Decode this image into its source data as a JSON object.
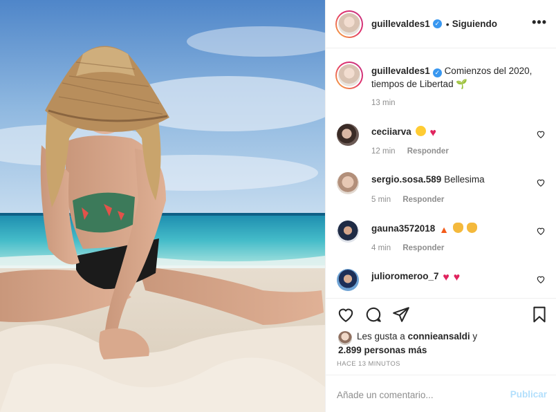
{
  "post": {
    "username": "guillevaldes1",
    "follow_state": "Siguiendo",
    "more_label": "•••",
    "verified_mark": "✓",
    "separator": "•"
  },
  "caption": {
    "username": "guillevaldes1",
    "text": "Comienzos del 2020, tiempos de Libertad",
    "emoji": "🌱",
    "time": "13 min"
  },
  "comments": [
    {
      "username": "ceciiarva",
      "text": "",
      "time": "12 min",
      "reply": "Responder"
    },
    {
      "username": "sergio.sosa.589",
      "text": "Bellesima",
      "time": "5 min",
      "reply": "Responder"
    },
    {
      "username": "gauna3572018",
      "text": "",
      "time": "4 min",
      "reply": "Responder"
    },
    {
      "username": "julioromeroo_7",
      "text": "",
      "time": "",
      "reply": ""
    }
  ],
  "likes": {
    "prefix": "Les gusta a",
    "user": "connieansaldi",
    "joiner": "y",
    "others": "2.899 personas más"
  },
  "posted_ago": "HACE 13 MINUTOS",
  "comment_box": {
    "placeholder": "Añade un comentario...",
    "publish_label": "Publicar"
  },
  "colors": {
    "accent": "#3897f0",
    "publish_disabled": "#b2dffc",
    "muted": "#8e8e8e",
    "heart": "#e0245e"
  },
  "icons": [
    "more-options-icon",
    "verified-icon",
    "like-icon",
    "comment-icon",
    "share-icon",
    "save-icon",
    "comment-like-icon"
  ]
}
